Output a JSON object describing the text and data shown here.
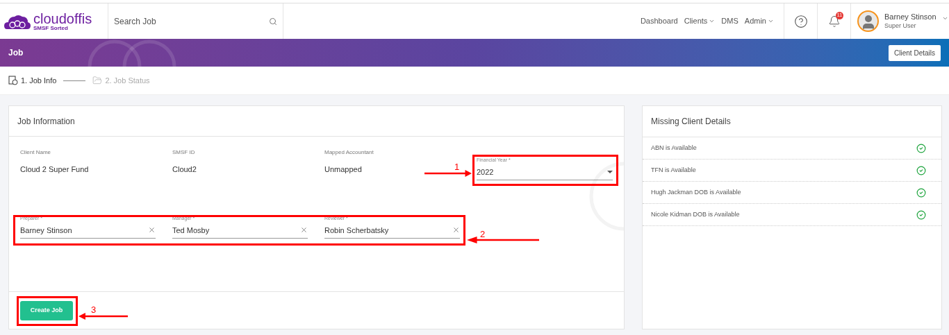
{
  "header": {
    "logo": {
      "name": "cloudoffis",
      "tagline": "SMSF Sorted"
    },
    "search": {
      "placeholder": "Search Job"
    },
    "nav": [
      {
        "label": "Dashboard",
        "dropdown": false
      },
      {
        "label": "Clients",
        "dropdown": true
      },
      {
        "label": "DMS",
        "dropdown": false
      },
      {
        "label": "Admin",
        "dropdown": true
      }
    ],
    "notifications": "11",
    "user": {
      "name": "Barney Stinson",
      "role": "Super User"
    }
  },
  "banner": {
    "title": "Job",
    "button": "Client Details"
  },
  "steps": [
    {
      "label": "1. Job Info",
      "selected": true
    },
    {
      "label": "2. Job Status",
      "selected": false
    }
  ],
  "job_information": {
    "title": "Job Information",
    "details": [
      {
        "label": "Client Name",
        "value": "Cloud 2 Super Fund"
      },
      {
        "label": "SMSF ID",
        "value": "Cloud2"
      },
      {
        "label": "Mapped Accountant",
        "value": "Unmapped"
      }
    ],
    "financial_year": {
      "label": "Financial Year *",
      "value": "2022"
    },
    "assignees": [
      {
        "label": "Preparer *",
        "value": "Barney Stinson"
      },
      {
        "label": "Manager *",
        "value": "Ted Mosby"
      },
      {
        "label": "Reviewer *",
        "value": "Robin Scherbatsky"
      }
    ],
    "button": "Create Job"
  },
  "missing_client_details": {
    "title": "Missing Client Details",
    "items": [
      {
        "text": "ABN is Available",
        "available": true
      },
      {
        "text": "TFN is Available",
        "available": true
      },
      {
        "text": "Hugh Jackman DOB is Available",
        "available": true
      },
      {
        "text": "Nicole Kidman DOB is Available",
        "available": true
      }
    ]
  },
  "annotations": [
    {
      "label": "1"
    },
    {
      "label": "2"
    },
    {
      "label": "3"
    }
  ]
}
